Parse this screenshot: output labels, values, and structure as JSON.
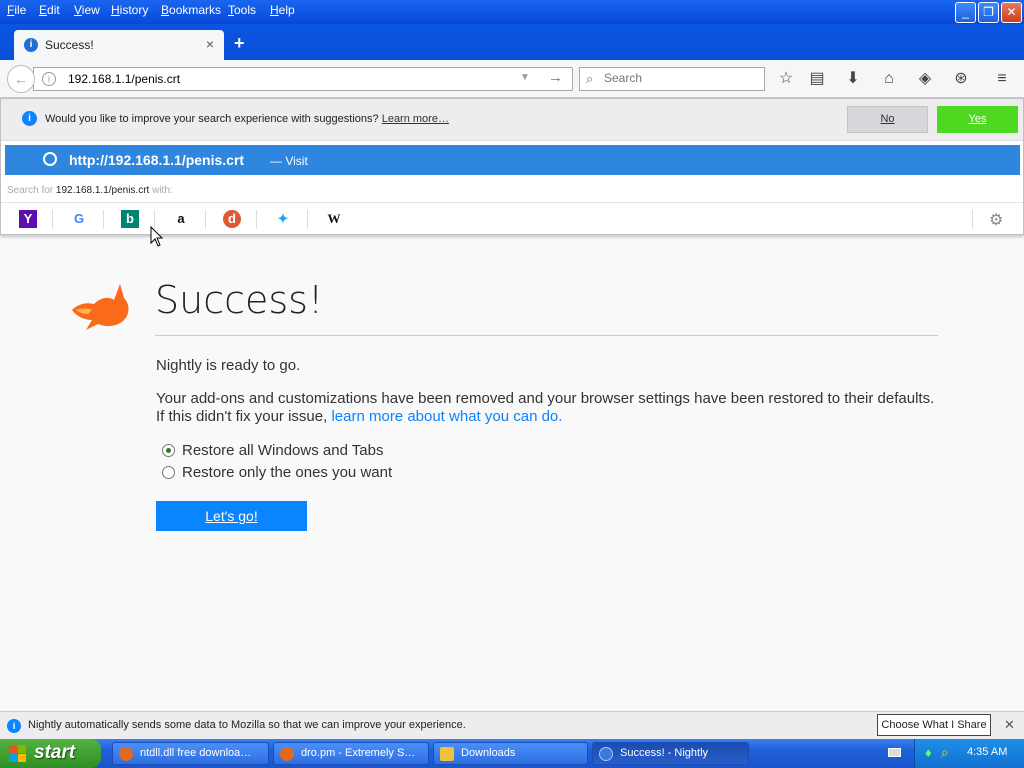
{
  "menu": [
    "File",
    "Edit",
    "View",
    "History",
    "Bookmarks",
    "Tools",
    "Help"
  ],
  "window_controls": {
    "minimize": "_",
    "maximize": "❐",
    "close": "✕"
  },
  "tab": {
    "title": "Success!",
    "close": "×",
    "new_tab": "+"
  },
  "navbar": {
    "url": "192.168.1.1/penis.crt",
    "search_placeholder": "Search",
    "icons": [
      "star-icon",
      "reading-list-icon",
      "download-icon",
      "home-icon",
      "pocket-icon",
      "sync-icon",
      "menu-icon"
    ]
  },
  "suggestions_prompt": {
    "message": "Would you like to improve your search experience with suggestions?",
    "learn_more": "Learn more…",
    "no": "No",
    "yes": "Yes"
  },
  "url_result": {
    "url": "http://192.168.1.1/penis.crt",
    "action": "— Visit"
  },
  "search_for": {
    "prefix": "Search for",
    "query": "192.168.1.1/penis.crt",
    "suffix": "with:"
  },
  "search_engines": [
    "Yahoo",
    "Google",
    "Bing",
    "Amazon",
    "DuckDuckGo",
    "Twitter",
    "Wikipedia"
  ],
  "page": {
    "title": "Success!",
    "ready": "Nightly is ready to go.",
    "desc_line1": "Your add-ons and customizations have been removed and your browser settings have been restored to their defaults.",
    "desc_line2": "If this didn't fix your issue,",
    "desc_link": "learn more about what you can do.",
    "options": [
      {
        "label": "Restore all Windows and Tabs",
        "selected": true
      },
      {
        "label": "Restore only the ones you want",
        "selected": false
      }
    ],
    "button": "Let's go!"
  },
  "notification": {
    "text": "Nightly automatically sends some data to Mozilla so that we can improve your experience.",
    "button": "Choose What I Share",
    "close": "✕"
  },
  "taskbar": {
    "start": "start",
    "tasks": [
      {
        "label": "ntdll.dll free downloa…",
        "active": false
      },
      {
        "label": "dro.pm - Extremely S…",
        "active": false
      },
      {
        "label": "Downloads",
        "active": false
      },
      {
        "label": "Success! - Nightly",
        "active": true
      }
    ],
    "clock": "4:35 AM"
  }
}
